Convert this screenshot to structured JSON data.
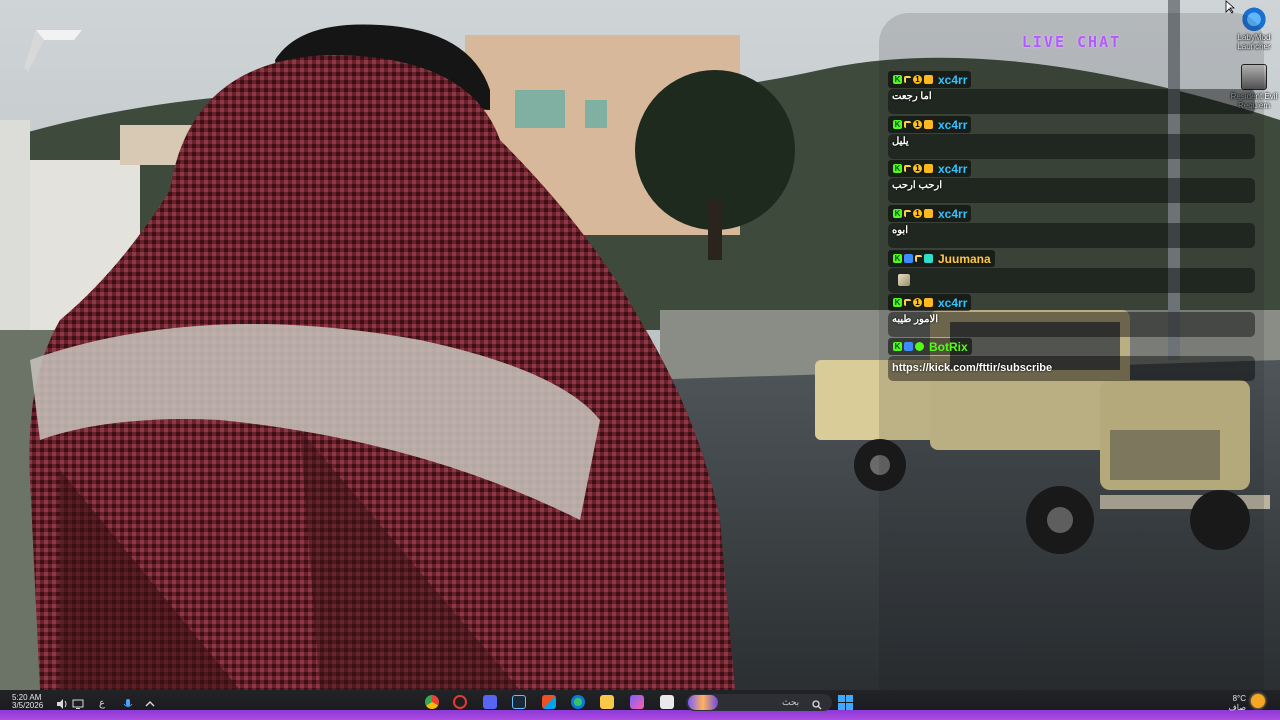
{
  "desktop": {
    "icons": [
      {
        "label": "LabyMod Launcher",
        "icon": "labymod-fox-icon"
      },
      {
        "label": "Resident Evil Requiem",
        "icon": "game-shortcut-icon"
      }
    ]
  },
  "chat": {
    "title": "LIVE CHAT",
    "messages": [
      {
        "user": "xc4rr",
        "user_color": "#33c3ff",
        "badges": [
          "kick",
          "flag",
          "one",
          "crown"
        ],
        "text": "اما رجعت"
      },
      {
        "user": "xc4rr",
        "user_color": "#33c3ff",
        "badges": [
          "kick",
          "flag",
          "one",
          "crown"
        ],
        "text": "يليل"
      },
      {
        "user": "xc4rr",
        "user_color": "#33c3ff",
        "badges": [
          "kick",
          "flag",
          "one",
          "crown"
        ],
        "text": "ارحب ارحب"
      },
      {
        "user": "xc4rr",
        "user_color": "#33c3ff",
        "badges": [
          "kick",
          "flag",
          "one",
          "crown"
        ],
        "text": "ابوه"
      },
      {
        "user": "Juumana",
        "user_color": "#ffc640",
        "badges": [
          "kick",
          "subscriber",
          "flag",
          "gift"
        ],
        "text": ""
      },
      {
        "user": "xc4rr",
        "user_color": "#33c3ff",
        "badges": [
          "kick",
          "flag",
          "one",
          "crown"
        ],
        "text": "الامور طيبه"
      },
      {
        "user": "BotRix",
        "user_color": "#53fc18",
        "badges": [
          "kick",
          "subscriber",
          "verified"
        ],
        "text": "https://kick.com/fttir/subscribe"
      }
    ]
  },
  "taskbar": {
    "time": "5:20 AM",
    "date": "3/5/2026",
    "language": "ع",
    "search_placeholder": "بحث",
    "weather_temp": "8°C",
    "weather_desc": "صاف",
    "apps": [
      "chrome-icon",
      "kick-app-icon",
      "discord-icon",
      "steam-icon",
      "store-icon",
      "edge-icon",
      "file-explorer-icon",
      "widgets-icon",
      "notepad-icon"
    ]
  },
  "colors": {
    "chat_title": "#b15cff",
    "taskbar_accent": "#b04ce0",
    "kick_green": "#53fc18"
  }
}
